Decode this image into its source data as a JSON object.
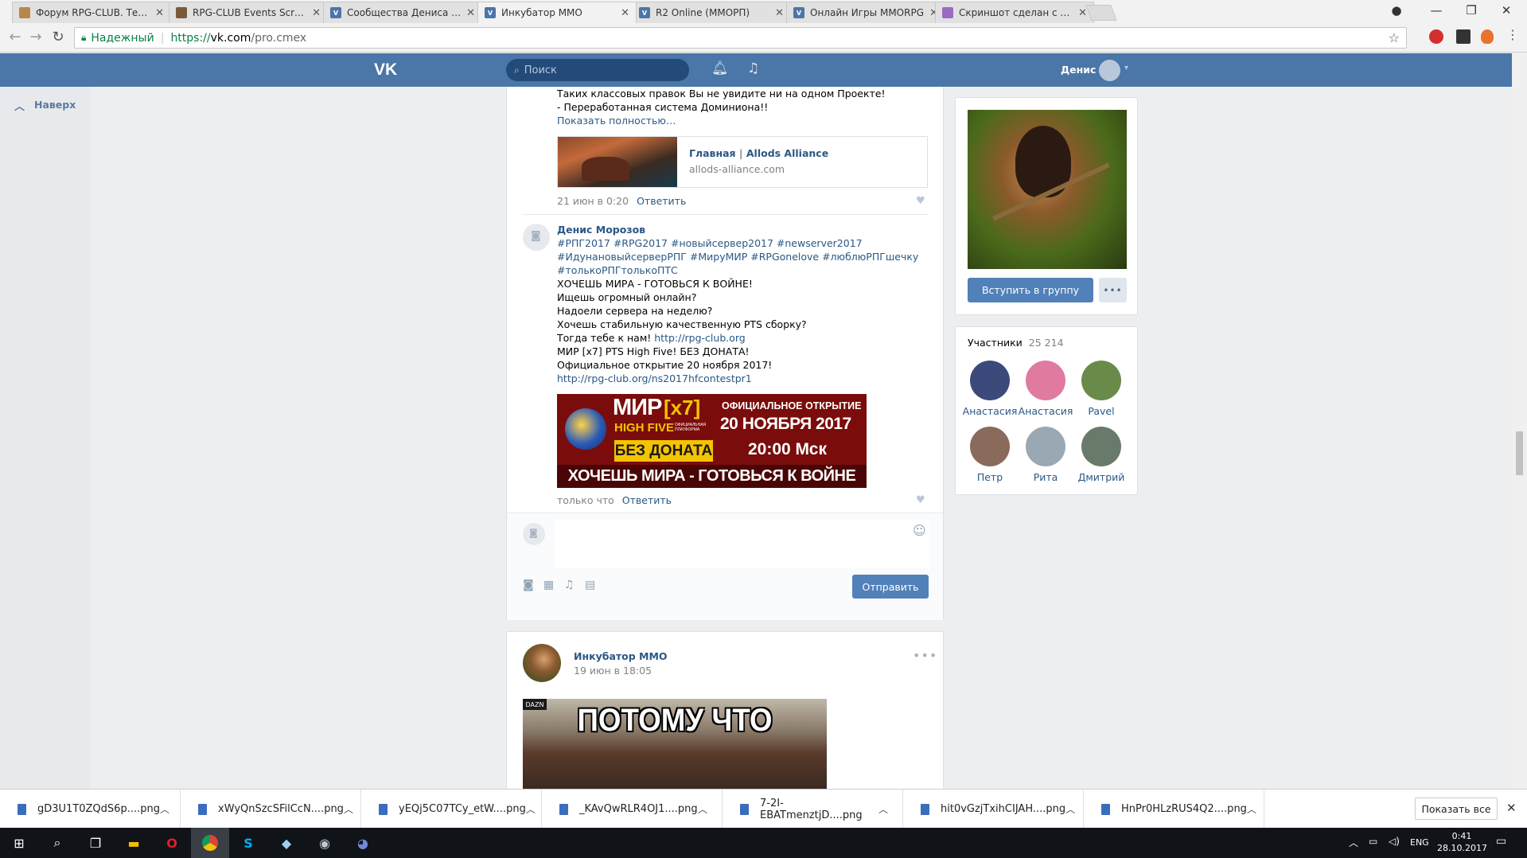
{
  "browser": {
    "tabs": [
      {
        "label": "Форум RPG-CLUB. Тема",
        "icon_color": "#b5884a"
      },
      {
        "label": "RPG-CLUB Events Screen",
        "icon_color": "#7a5a3a"
      },
      {
        "label": "Сообщества Дениса Мо",
        "icon_color": "#4a76a8"
      },
      {
        "label": "Инкубатор ММО",
        "icon_color": "#4a76a8"
      },
      {
        "label": "R2 Online (ММОРП)",
        "icon_color": "#4a76a8"
      },
      {
        "label": "Онлайн Игры MMORPG",
        "icon_color": "#4a76a8"
      },
      {
        "label": "Скриншот сделан с пом",
        "icon_color": "#9a6bc4"
      }
    ],
    "secure_label": "Надежный",
    "url_prefix": "https://",
    "url_host": "vk.com",
    "url_path": "/pro.cmex"
  },
  "vk_header": {
    "logo": "VK",
    "search_placeholder": "Поиск",
    "user_name": "Денис",
    "brand_color": "#4a76a8"
  },
  "sidebar": {
    "back_to_top": "Наверх"
  },
  "comment1": {
    "lines": [
      "Таких классовых правок Вы не увидите ни на одном Проекте!",
      "- Переработанная система Доминиона!!"
    ],
    "show_more": "Показать полностью…",
    "link_title_a": "Главная",
    "link_title_sep": " | ",
    "link_title_b": "Allods Alliance",
    "link_domain": "allods-alliance.com",
    "time": "21 июн в 0:20",
    "reply": "Ответить"
  },
  "comment2": {
    "author": "Денис Морозов",
    "hashtags": [
      "#РПГ2017 #RPG2017 #новыйсервер2017 #newserver2017",
      "#ИдунановыйсерверРПГ #МируМИР #RPGonelove #люблюРПГшечку",
      "#толькоРПГтолькоПТС"
    ],
    "lines": [
      "ХОЧЕШЬ МИРА - ГОТОВЬСЯ К ВОЙНЕ!",
      "Ищешь огромный онлайн?",
      "Надоели сервера на неделю?",
      "Хочешь стабильную качественную PTS сборку?"
    ],
    "line_with_link_text": "Тогда тебе к нам! ",
    "line_with_link_url": "http://rpg-club.org",
    "lines2": [
      "МИР [x7] PTS High Five! БЕЗ ДОНАТА!",
      "Официальное открытие 20 ноября 2017!"
    ],
    "bottom_link": "http://rpg-club.org/ns2017hfcontestpr1",
    "banner": {
      "mir": "МИР",
      "x7": "[x7]",
      "high_five": "HIGH FIVE",
      "platform": "ОФИЦИАЛЬНАЯ ПЛАТФОРМА",
      "official": "ОФИЦИАЛЬНОЕ ОТКРЫТИЕ",
      "date": "20 НОЯБРЯ 2017",
      "no_donate": "БЕЗ ДОНАТА",
      "time": "20:00 Мск",
      "slogan": "ХОЧЕШЬ МИРА - ГОТОВЬСЯ К ВОЙНЕ"
    },
    "time": "только что",
    "reply": "Ответить"
  },
  "composer": {
    "send": "Отправить"
  },
  "post2": {
    "author": "Инкубатор ММО",
    "time": "19 июн в 18:05",
    "image_caption": "ПОТОМУ ЧТО",
    "image_tag": "DAZN"
  },
  "right": {
    "join": "Вступить в группу",
    "members_label": "Участники",
    "members_count": "25 214",
    "members": [
      {
        "name": "Анастасия",
        "color": "#3b4a7a"
      },
      {
        "name": "Анастасия",
        "color": "#e07aa0"
      },
      {
        "name": "Pavel",
        "color": "#6a8a4a"
      },
      {
        "name": "Петр",
        "color": "#8a6a5a"
      },
      {
        "name": "Рита",
        "color": "#9aa8b4"
      },
      {
        "name": "Дмитрий",
        "color": "#6a7a6a"
      }
    ]
  },
  "downloads": {
    "items": [
      "gD3U1T0ZQdS6p....png",
      "xWyQnSzcSFilCcN....png",
      "yEQj5C07TCy_etW....png",
      "_KAvQwRLR4OJ1....png",
      "7-2I-EBATmenztjD....png",
      "hit0vGzjTxihCIJAH....png",
      "HnPr0HLzRUS4Q2....png"
    ],
    "show_all": "Показать все"
  },
  "taskbar": {
    "lang": "ENG",
    "time": "0:41",
    "date": "28.10.2017"
  }
}
